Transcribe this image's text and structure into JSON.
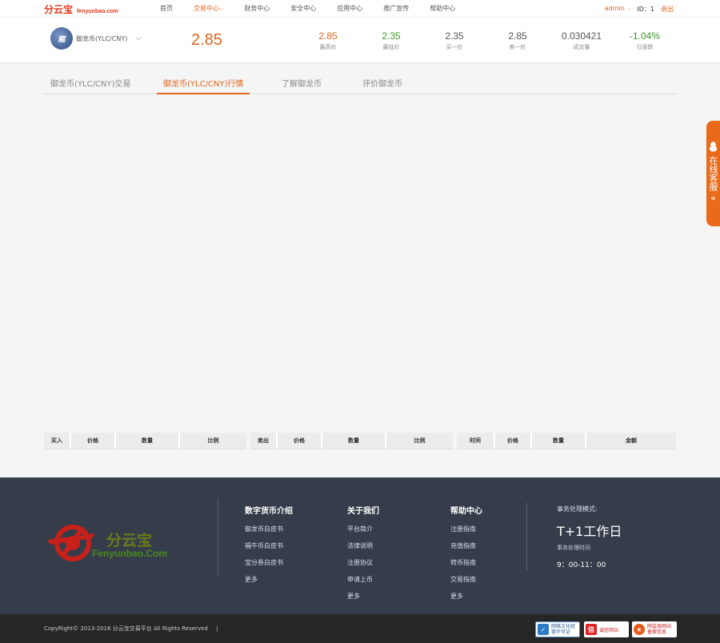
{
  "nav": {
    "brand": "分云宝",
    "domain": "fenyunbao.com",
    "items": [
      {
        "label": "首页",
        "active": false
      },
      {
        "label": "交易中心",
        "active": true
      },
      {
        "label": "财务中心",
        "active": false
      },
      {
        "label": "安全中心",
        "active": false
      },
      {
        "label": "应用中心",
        "active": false
      },
      {
        "label": "推广宣传",
        "active": false
      },
      {
        "label": "帮助中心",
        "active": false
      }
    ],
    "user": "admin",
    "id_label": "ID：1",
    "logout": "退出"
  },
  "ticker": {
    "coin_name": "御龙币(YLC/CNY)",
    "price": "2.85",
    "stats": [
      {
        "value": "2.85",
        "label": "最高价",
        "color": "#e0661f"
      },
      {
        "value": "2.35",
        "label": "最低价",
        "color": "#3a9a2a"
      },
      {
        "value": "2.35",
        "label": "买一价",
        "color": "#555555"
      },
      {
        "value": "2.85",
        "label": "卖一价",
        "color": "#555555"
      },
      {
        "value": "0.030421",
        "label": "成交量",
        "color": "#555555"
      },
      {
        "value": "-1.04%",
        "label": "日涨跌",
        "color": "#3a9a2a"
      }
    ]
  },
  "tabs": [
    {
      "label": "御龙币(YLC/CNY)交易",
      "active": false
    },
    {
      "label": "御龙币(YLC/CNY)行情",
      "active": true
    },
    {
      "label": "了解御龙币",
      "active": false
    },
    {
      "label": "评价御龙币",
      "active": false
    }
  ],
  "tables": {
    "buy": [
      "买入",
      "价格",
      "数量",
      "比例"
    ],
    "sell": [
      "卖出",
      "价格",
      "数量",
      "比例"
    ],
    "trades": [
      "时间",
      "价格",
      "数量",
      "金额"
    ]
  },
  "chat": {
    "text": "在线客服",
    "arrow": "«"
  },
  "footer": {
    "logo_text": "分云宝",
    "logo_sub": "Fenyunbao.Com",
    "cols": [
      {
        "title": "数字货币介绍",
        "items": [
          "御龙币白皮书",
          "福牛币白皮书",
          "宝分券白皮书",
          "更多"
        ]
      },
      {
        "title": "关于我们",
        "items": [
          "平台简介",
          "法律说明",
          "注册协议",
          "申请上币",
          "更多"
        ]
      },
      {
        "title": "帮助中心",
        "items": [
          "注册指南",
          "充值指南",
          "转币指南",
          "交易指南",
          "更多"
        ]
      }
    ],
    "service": {
      "label": "事务处理模式:",
      "mode": "T+1工作日",
      "time_label": "事务处理时间",
      "time": "9：00-11：00"
    }
  },
  "bottom": {
    "copyright": "CopyRight© 2013-2016 分云宝交易平台 All Rights Reserved",
    "sep": "|",
    "badges": [
      {
        "text": "网络文化经营许可证"
      },
      {
        "text": "诚信网站"
      },
      {
        "text": "网监局网站备案信息"
      }
    ]
  }
}
